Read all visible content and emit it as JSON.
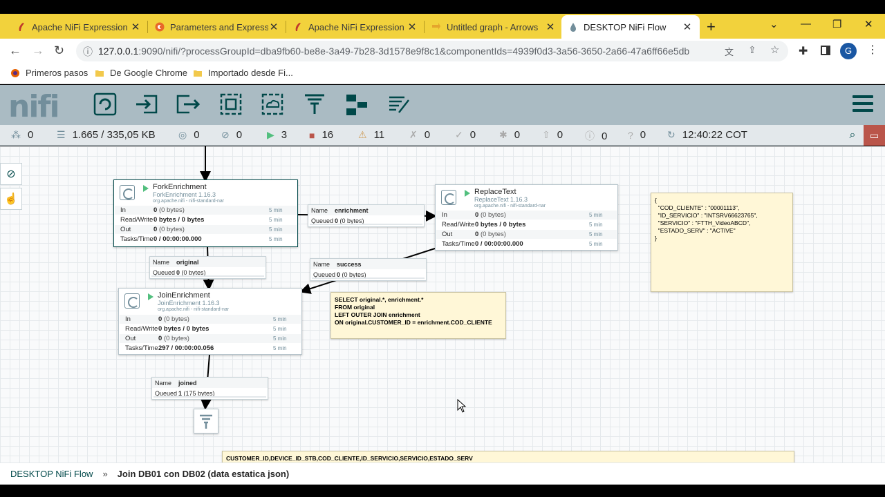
{
  "browser": {
    "tabs": [
      {
        "label": "Apache NiFi Expression La",
        "icon": "nifi-feather-icon"
      },
      {
        "label": "Parameters and Expressio",
        "icon": "cloudera-icon"
      },
      {
        "label": "Apache NiFi Expression La",
        "icon": "nifi-feather-icon"
      },
      {
        "label": "Untitled graph - Arrows",
        "icon": "arrows-icon"
      },
      {
        "label": "DESKTOP NiFi Flow",
        "icon": "nifi-drop-icon"
      }
    ],
    "url_host": "127.0.0.1",
    "url_path": ":9090/nifi/?processGroupId=dba9fb60-be8e-3a49-7b28-3d1578e9f8c1&componentIds=4939f0d3-3a56-3650-2a66-47a6ff66e5db",
    "profile_initial": "G",
    "bookmarks": [
      "Primeros pasos",
      "De Google Chrome",
      "Importado desde Fi..."
    ]
  },
  "nifi": {
    "logo": "nifi",
    "status": {
      "active_threads": "0",
      "queued": "1.665 / 335,05 KB",
      "transmitting": "0",
      "not_transmitting": "0",
      "running": "3",
      "stopped": "16",
      "invalid": "11",
      "disabled": "0",
      "up_to_date": "0",
      "locally_modified": "0",
      "stale": "0",
      "locally_modified_stale": "0",
      "sync_failure": "0",
      "last_refreshed": "12:40:22 COT"
    },
    "processors": {
      "fork": {
        "name": "ForkEnrichment",
        "type": "ForkEnrichment 1.16.3",
        "bundle": "org.apache.nifi - nifi-standard-nar",
        "in": "0",
        "in_bytes": "(0 bytes)",
        "rw": "0 bytes / 0 bytes",
        "out": "0",
        "out_bytes": "(0 bytes)",
        "tasks": "0 / 00:00:00.000",
        "window": "5 min"
      },
      "replace": {
        "name": "ReplaceText",
        "type": "ReplaceText 1.16.3",
        "bundle": "org.apache.nifi - nifi-standard-nar",
        "in": "0",
        "in_bytes": "(0 bytes)",
        "rw": "0 bytes / 0 bytes",
        "out": "0",
        "out_bytes": "(0 bytes)",
        "tasks": "0 / 00:00:00.000",
        "window": "5 min"
      },
      "join": {
        "name": "JoinEnrichment",
        "type": "JoinEnrichment 1.16.3",
        "bundle": "org.apache.nifi - nifi-standard-nar",
        "in": "0",
        "in_bytes": "(0 bytes)",
        "rw": "0 bytes / 0 bytes",
        "out": "0",
        "out_bytes": "(0 bytes)",
        "tasks": "297 / 00:00:00.056",
        "window": "5 min"
      }
    },
    "row_labels": {
      "in": "In",
      "rw": "Read/Write",
      "out": "Out",
      "tasks": "Tasks/Time"
    },
    "connections": {
      "enrichment": {
        "name_key": "Name",
        "name": "enrichment",
        "queued_key": "Queued",
        "queued": "0",
        "queued_bytes": "(0 bytes)"
      },
      "original": {
        "name_key": "Name",
        "name": "original",
        "queued_key": "Queued",
        "queued": "0",
        "queued_bytes": "(0 bytes)"
      },
      "success": {
        "name_key": "Name",
        "name": "success",
        "queued_key": "Queued",
        "queued": "0",
        "queued_bytes": "(0 bytes)"
      },
      "joined": {
        "name_key": "Name",
        "name": "joined",
        "queued_key": "Queued",
        "queued": "1",
        "queued_bytes": "(175 bytes)"
      }
    },
    "labels": {
      "sql": "SELECT original.*, enrichment.*\nFROM original\nLEFT OUTER JOIN enrichment\nON original.CUSTOMER_ID = enrichment.COD_CLIENTE",
      "json": "{\n  \"COD_CLIENTE\" : \"00001113\",\n  \"ID_SERVICIO\" : \"INTSRV66623765\",\n  \"SERVICIO\" : \"FTTH_VideoABCD\",\n  \"ESTADO_SERV\" : \"ACTIVE\"\n}",
      "csv_header": "CUSTOMER_ID,DEVICE_ID_STB,COD_CLIENTE,ID_SERVICIO,SERVICIO,ESTADO_SERV"
    },
    "breadcrumb": {
      "root": "DESKTOP NiFi Flow",
      "sep": "»",
      "current": "Join DB01 con DB02 (data estatica json)"
    }
  },
  "colors": {
    "tabbar": "#f2d23c",
    "nifi_header": "#aabbc3",
    "nifi_dark": "#004849",
    "running": "#52bf7e",
    "stopped": "#ba554a",
    "invalid": "#cf9f5d"
  }
}
